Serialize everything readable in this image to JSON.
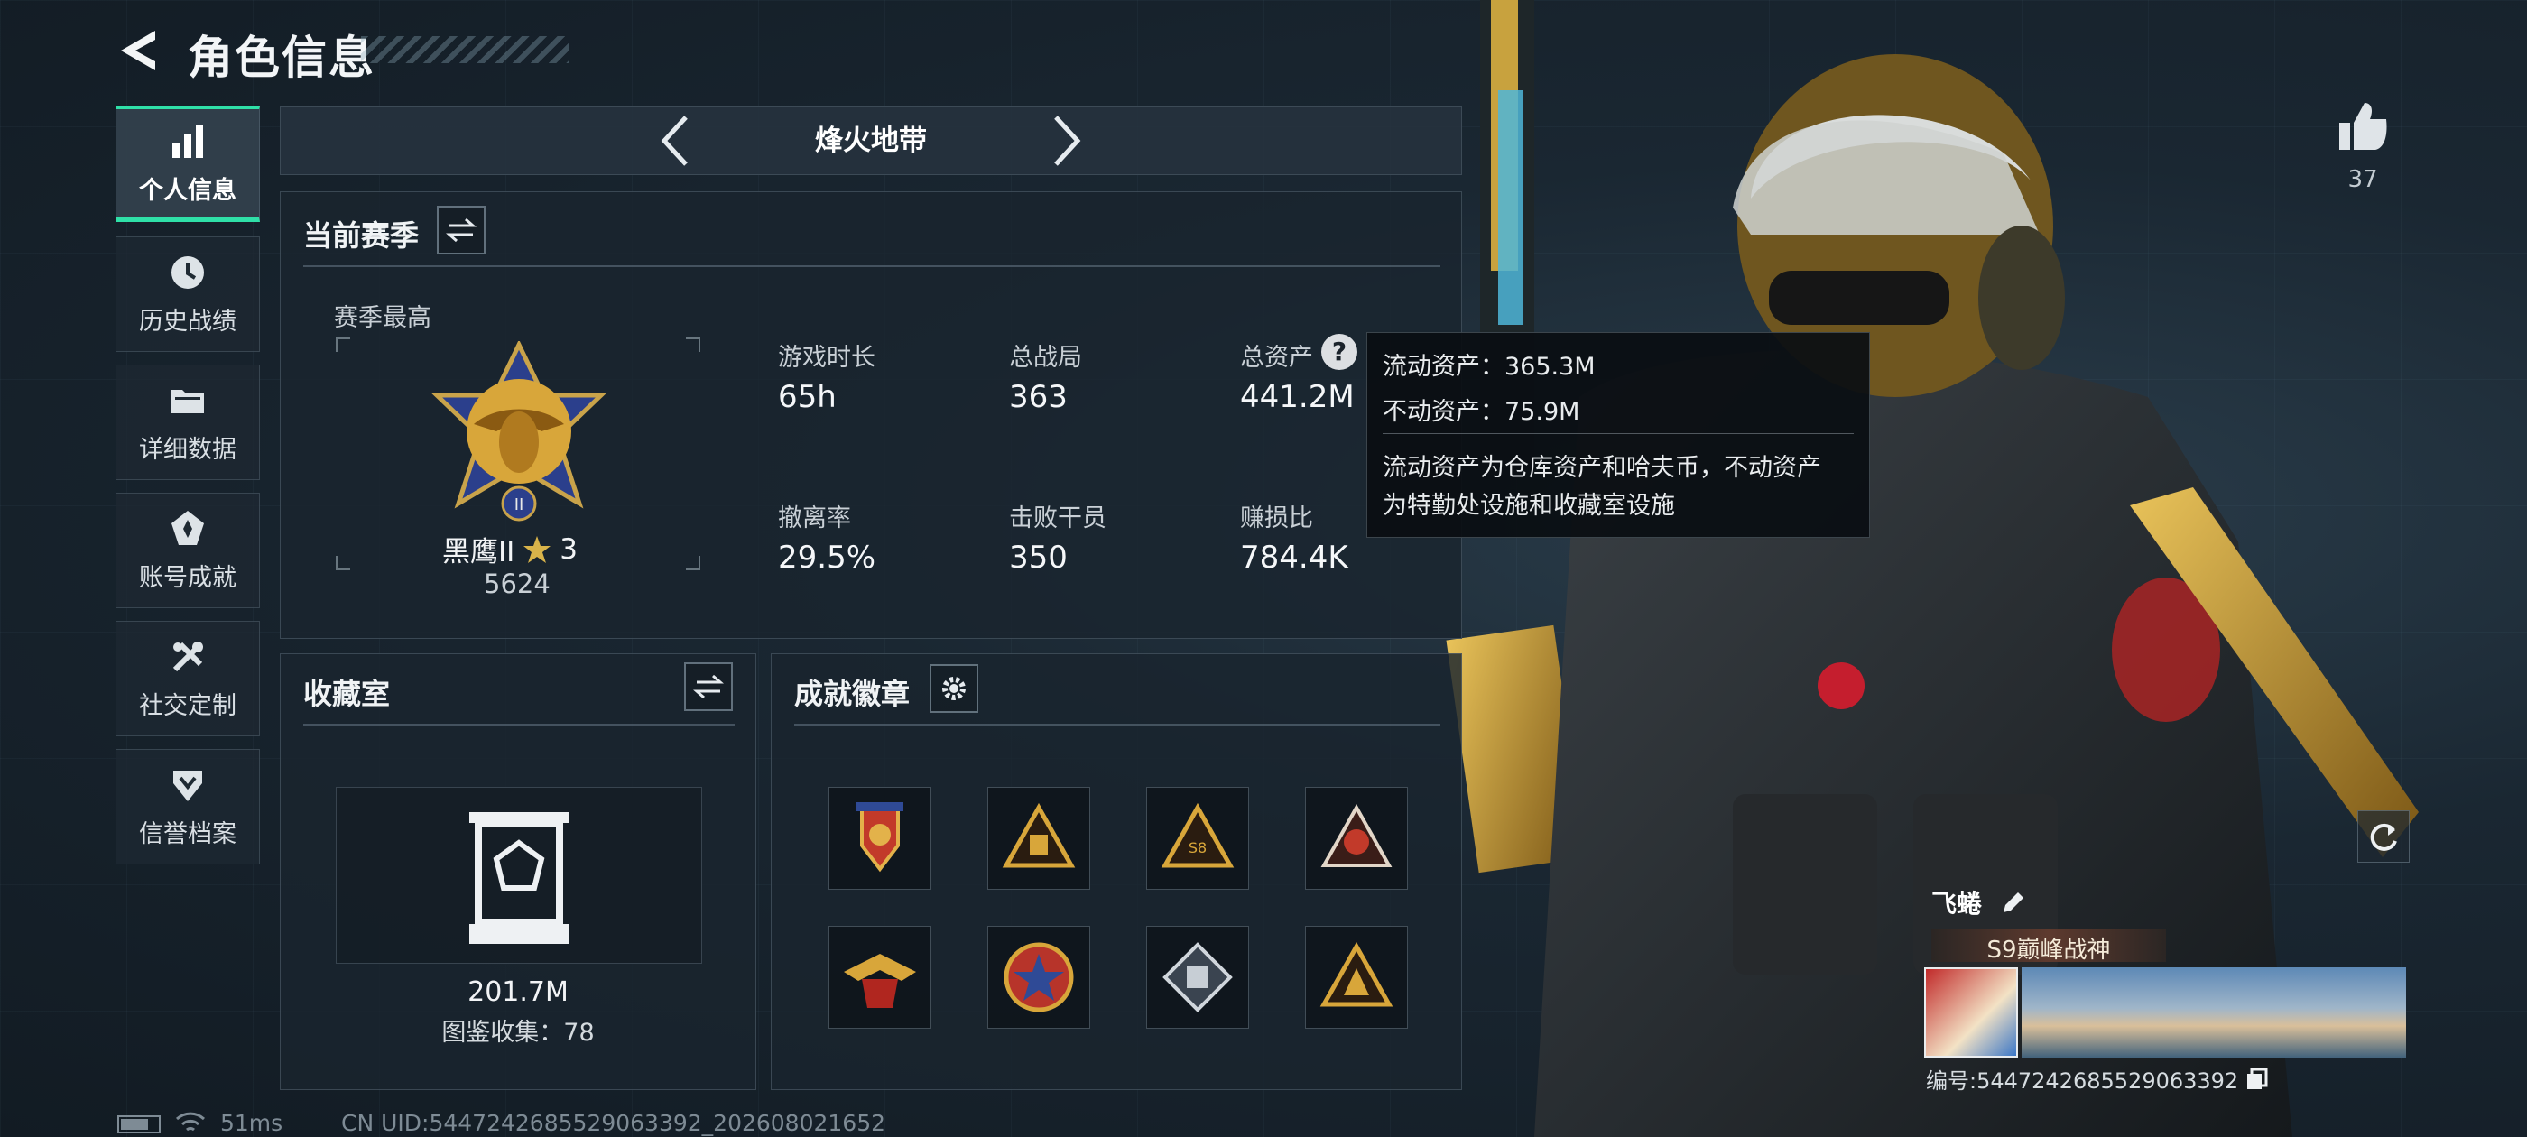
{
  "header": {
    "title": "角色信息"
  },
  "sidebar": {
    "items": [
      {
        "label": "个人信息",
        "icon": "bar-chart-icon",
        "active": true
      },
      {
        "label": "历史战绩",
        "icon": "history-clock-icon",
        "active": false
      },
      {
        "label": "详细数据",
        "icon": "folder-icon",
        "active": false
      },
      {
        "label": "账号成就",
        "icon": "achievement-medal-icon",
        "active": false
      },
      {
        "label": "社交定制",
        "icon": "wrench-tools-icon",
        "active": false
      },
      {
        "label": "信誉档案",
        "icon": "shield-chevron-icon",
        "active": false
      }
    ]
  },
  "mode": {
    "title": "烽火地带"
  },
  "season": {
    "title": "当前赛季",
    "best_label": "赛季最高",
    "rank_name": "黑鹰II",
    "rank_stars": "3",
    "rank_score": "5624",
    "stats": [
      {
        "label": "游戏时长",
        "value": "65h"
      },
      {
        "label": "总战局",
        "value": "363"
      },
      {
        "label": "总资产",
        "value": "441.2M"
      },
      {
        "label": "撤离率",
        "value": "29.5%"
      },
      {
        "label": "击败干员",
        "value": "350"
      },
      {
        "label": "赚损比",
        "value": "784.4K"
      }
    ]
  },
  "tooltip": {
    "liquid": "流动资产：365.3M",
    "fixed": "不动资产：75.9M",
    "desc_line1": "流动资产为仓库资产和哈夫币，不动资产",
    "desc_line2": "为特勤处设施和收藏室设施"
  },
  "collection": {
    "title": "收藏室",
    "value": "201.7M",
    "catalog": "图鉴收集：78"
  },
  "badges": {
    "title": "成就徽章",
    "items": [
      "red-eagle-badge-icon",
      "sunset-pyramid-badge-icon",
      "s8-pyramid-badge-icon",
      "s9-emblem-badge-icon",
      "s10-wings-badge-icon",
      "star-shield-badge-icon",
      "diamond-chip-badge-icon",
      "gold-pyramid-badge-icon"
    ]
  },
  "likes": {
    "count": "37"
  },
  "player": {
    "name": "飞蜷",
    "title": "S9巅峰战神",
    "id_text": "编号:544724268552906339​2"
  },
  "status_bar": {
    "ping": "51ms",
    "uid": "CN UID:5447242685529063392_202608021652"
  },
  "colors": {
    "accent": "#2fe0a8",
    "gold": "#d8a63a",
    "panel": "#1a242e"
  }
}
